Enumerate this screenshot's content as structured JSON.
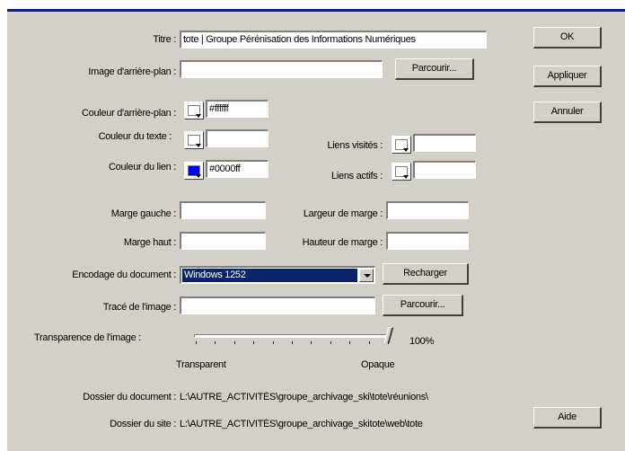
{
  "fields": {
    "title_label": "Titre :",
    "title_value": "tote | Groupe Pérénisation des Informations Numériques",
    "bg_image_label": "Image d'arrière-plan :",
    "bg_image_value": "",
    "bg_color_label": "Couleur d'arrière-plan :",
    "bg_color_value": "#ffffff",
    "text_color_label": "Couleur du texte :",
    "text_color_value": "",
    "link_color_label": "Couleur du lien :",
    "link_color_value": "#0000ff",
    "visited_links_label": "Liens visités :",
    "visited_links_value": "",
    "active_links_label": "Liens actifs :",
    "active_links_value": "",
    "left_margin_label": "Marge gauche :",
    "left_margin_value": "",
    "margin_width_label": "Largeur de marge :",
    "margin_width_value": "",
    "top_margin_label": "Marge haut :",
    "top_margin_value": "",
    "margin_height_label": "Hauteur de marge :",
    "margin_height_value": "",
    "encoding_label": "Encodage du document :",
    "encoding_value": "Windows 1252",
    "tracing_label": "Tracé de l'image :",
    "tracing_value": "",
    "transparency_label": "Transparence de l'image :",
    "transparency_value": "100%",
    "transparency_level": 1.0,
    "transparent_label": "Transparent",
    "opaque_label": "Opaque",
    "doc_folder_label": "Dossier du document :",
    "doc_folder_value": "L:\\AUTRE_ACTIVITÉS\\groupe_archivage_ski\\tote\\réunions\\",
    "site_folder_label": "Dossier du site :",
    "site_folder_value": "L:\\AUTRE_ACTIVITÉS\\groupe_archivage_skitote\\web\\tote"
  },
  "buttons": {
    "ok": "OK",
    "apply": "Appliquer",
    "cancel": "Annuler",
    "help": "Aide",
    "browse1": "Parcourir...",
    "reload": "Recharger",
    "browse2": "Parcourir..."
  },
  "colors": {
    "bg_swatch": "#ffffff",
    "text_swatch": "#ffffff",
    "link_swatch": "#0000ff",
    "visited_swatch": "#ffffff",
    "active_swatch": "#ffffff",
    "selection": "#0a246a",
    "dialog_bg": "#d4d0c8"
  }
}
